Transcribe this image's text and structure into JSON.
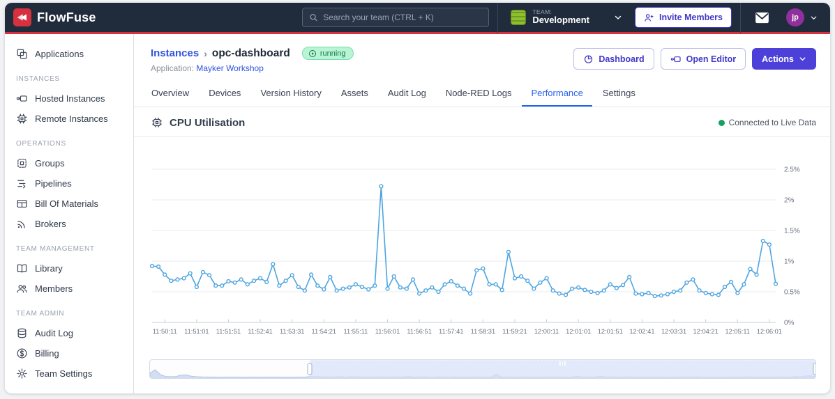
{
  "navbar": {
    "brand": "FlowFuse",
    "search_placeholder": "Search your team (CTRL + K)",
    "team_label": "TEAM:",
    "team_name": "Development",
    "invite_button": "Invite Members",
    "avatar_initials": "jp"
  },
  "sidebar": {
    "sections": [
      {
        "label": "",
        "items": [
          {
            "label": "Applications",
            "icon": "applications-icon"
          }
        ]
      },
      {
        "label": "INSTANCES",
        "items": [
          {
            "label": "Hosted Instances",
            "icon": "hosted-instances-icon"
          },
          {
            "label": "Remote Instances",
            "icon": "remote-instances-icon"
          }
        ]
      },
      {
        "label": "OPERATIONS",
        "items": [
          {
            "label": "Groups",
            "icon": "groups-icon"
          },
          {
            "label": "Pipelines",
            "icon": "pipelines-icon"
          },
          {
            "label": "Bill Of Materials",
            "icon": "bill-of-materials-icon"
          },
          {
            "label": "Brokers",
            "icon": "brokers-icon"
          }
        ]
      },
      {
        "label": "TEAM MANAGEMENT",
        "items": [
          {
            "label": "Library",
            "icon": "library-icon"
          },
          {
            "label": "Members",
            "icon": "members-icon"
          }
        ]
      },
      {
        "label": "TEAM ADMIN",
        "items": [
          {
            "label": "Audit Log",
            "icon": "audit-log-icon"
          },
          {
            "label": "Billing",
            "icon": "billing-icon"
          },
          {
            "label": "Team Settings",
            "icon": "team-settings-icon"
          }
        ]
      }
    ]
  },
  "header": {
    "breadcrumb_root": "Instances",
    "breadcrumb_separator": "›",
    "instance_name": "opc-dashboard",
    "status_badge": "running",
    "application_label": "Application:",
    "application_name": "Mayker Workshop",
    "buttons": {
      "dashboard": "Dashboard",
      "open_editor": "Open Editor",
      "actions": "Actions"
    }
  },
  "tabs": {
    "items": [
      "Overview",
      "Devices",
      "Version History",
      "Assets",
      "Audit Log",
      "Node-RED Logs",
      "Performance",
      "Settings"
    ],
    "active": "Performance"
  },
  "panel": {
    "title": "CPU Utilisation",
    "status": "Connected to Live Data"
  },
  "colors": {
    "navbar_bg": "#202b3c",
    "brand_red": "#d5313f",
    "link_blue": "#2f55e0",
    "active_tab_blue": "#2563eb",
    "indigo_button": "#4c40d9",
    "line_blue": "#4ea5e0",
    "live_green": "#17a05e",
    "badge_green_bg": "#b9f4d4",
    "badge_green_text": "#12784a"
  },
  "chart_data": {
    "type": "line",
    "title": "CPU Utilisation",
    "unit": "%",
    "sample_interval_seconds": 10,
    "x_tick_labels": [
      "11:50:11",
      "11:51:01",
      "11:51:51",
      "11:52:41",
      "11:53:31",
      "11:54:21",
      "11:55:11",
      "11:56:01",
      "11:56:51",
      "11:57:41",
      "11:58:31",
      "11:59:21",
      "12:00:11",
      "12:01:01",
      "12:01:51",
      "12:02:41",
      "12:03:31",
      "12:04:21",
      "12:05:11",
      "12:06:01"
    ],
    "tick_start_index": 2,
    "tick_every": 5,
    "ylim": [
      0,
      2.85
    ],
    "y_ticks": [
      0,
      0.5,
      1,
      1.5,
      2,
      2.5
    ],
    "y_tick_labels": [
      "0%",
      "0.5%",
      "1%",
      "1.5%",
      "2%",
      "2.5%"
    ],
    "grid": "horizontal-only",
    "legend": "none",
    "line_color": "#4ea5e0",
    "values": [
      0.92,
      0.91,
      0.78,
      0.68,
      0.7,
      0.72,
      0.8,
      0.58,
      0.82,
      0.77,
      0.6,
      0.6,
      0.67,
      0.65,
      0.7,
      0.62,
      0.68,
      0.72,
      0.66,
      0.95,
      0.6,
      0.68,
      0.77,
      0.58,
      0.52,
      0.78,
      0.6,
      0.54,
      0.74,
      0.52,
      0.55,
      0.57,
      0.62,
      0.58,
      0.54,
      0.6,
      2.22,
      0.55,
      0.75,
      0.57,
      0.55,
      0.7,
      0.47,
      0.52,
      0.57,
      0.5,
      0.62,
      0.67,
      0.6,
      0.55,
      0.47,
      0.85,
      0.88,
      0.62,
      0.62,
      0.53,
      1.15,
      0.72,
      0.75,
      0.68,
      0.55,
      0.65,
      0.72,
      0.52,
      0.47,
      0.45,
      0.55,
      0.57,
      0.53,
      0.5,
      0.48,
      0.52,
      0.62,
      0.56,
      0.61,
      0.74,
      0.47,
      0.46,
      0.48,
      0.43,
      0.44,
      0.46,
      0.5,
      0.52,
      0.65,
      0.7,
      0.52,
      0.48,
      0.46,
      0.45,
      0.58,
      0.66,
      0.48,
      0.62,
      0.87,
      0.78,
      1.33,
      1.27,
      0.63
    ],
    "navigator": {
      "selection_start_pct": 24,
      "selection_end_pct": 100,
      "ylim": [
        0,
        9
      ],
      "lead_in_values": [
        3.0,
        4.9,
        2.1,
        1.0,
        0.8,
        0.9,
        1.7,
        1.9,
        1.1,
        0.8,
        0.7,
        0.65,
        0.6,
        0.62,
        0.58,
        0.6,
        0.62,
        0.6,
        0.58,
        0.6,
        0.62,
        0.6,
        0.58,
        0.6,
        0.62,
        0.6,
        0.58,
        0.56,
        0.6,
        0.62,
        0.6
      ]
    }
  }
}
